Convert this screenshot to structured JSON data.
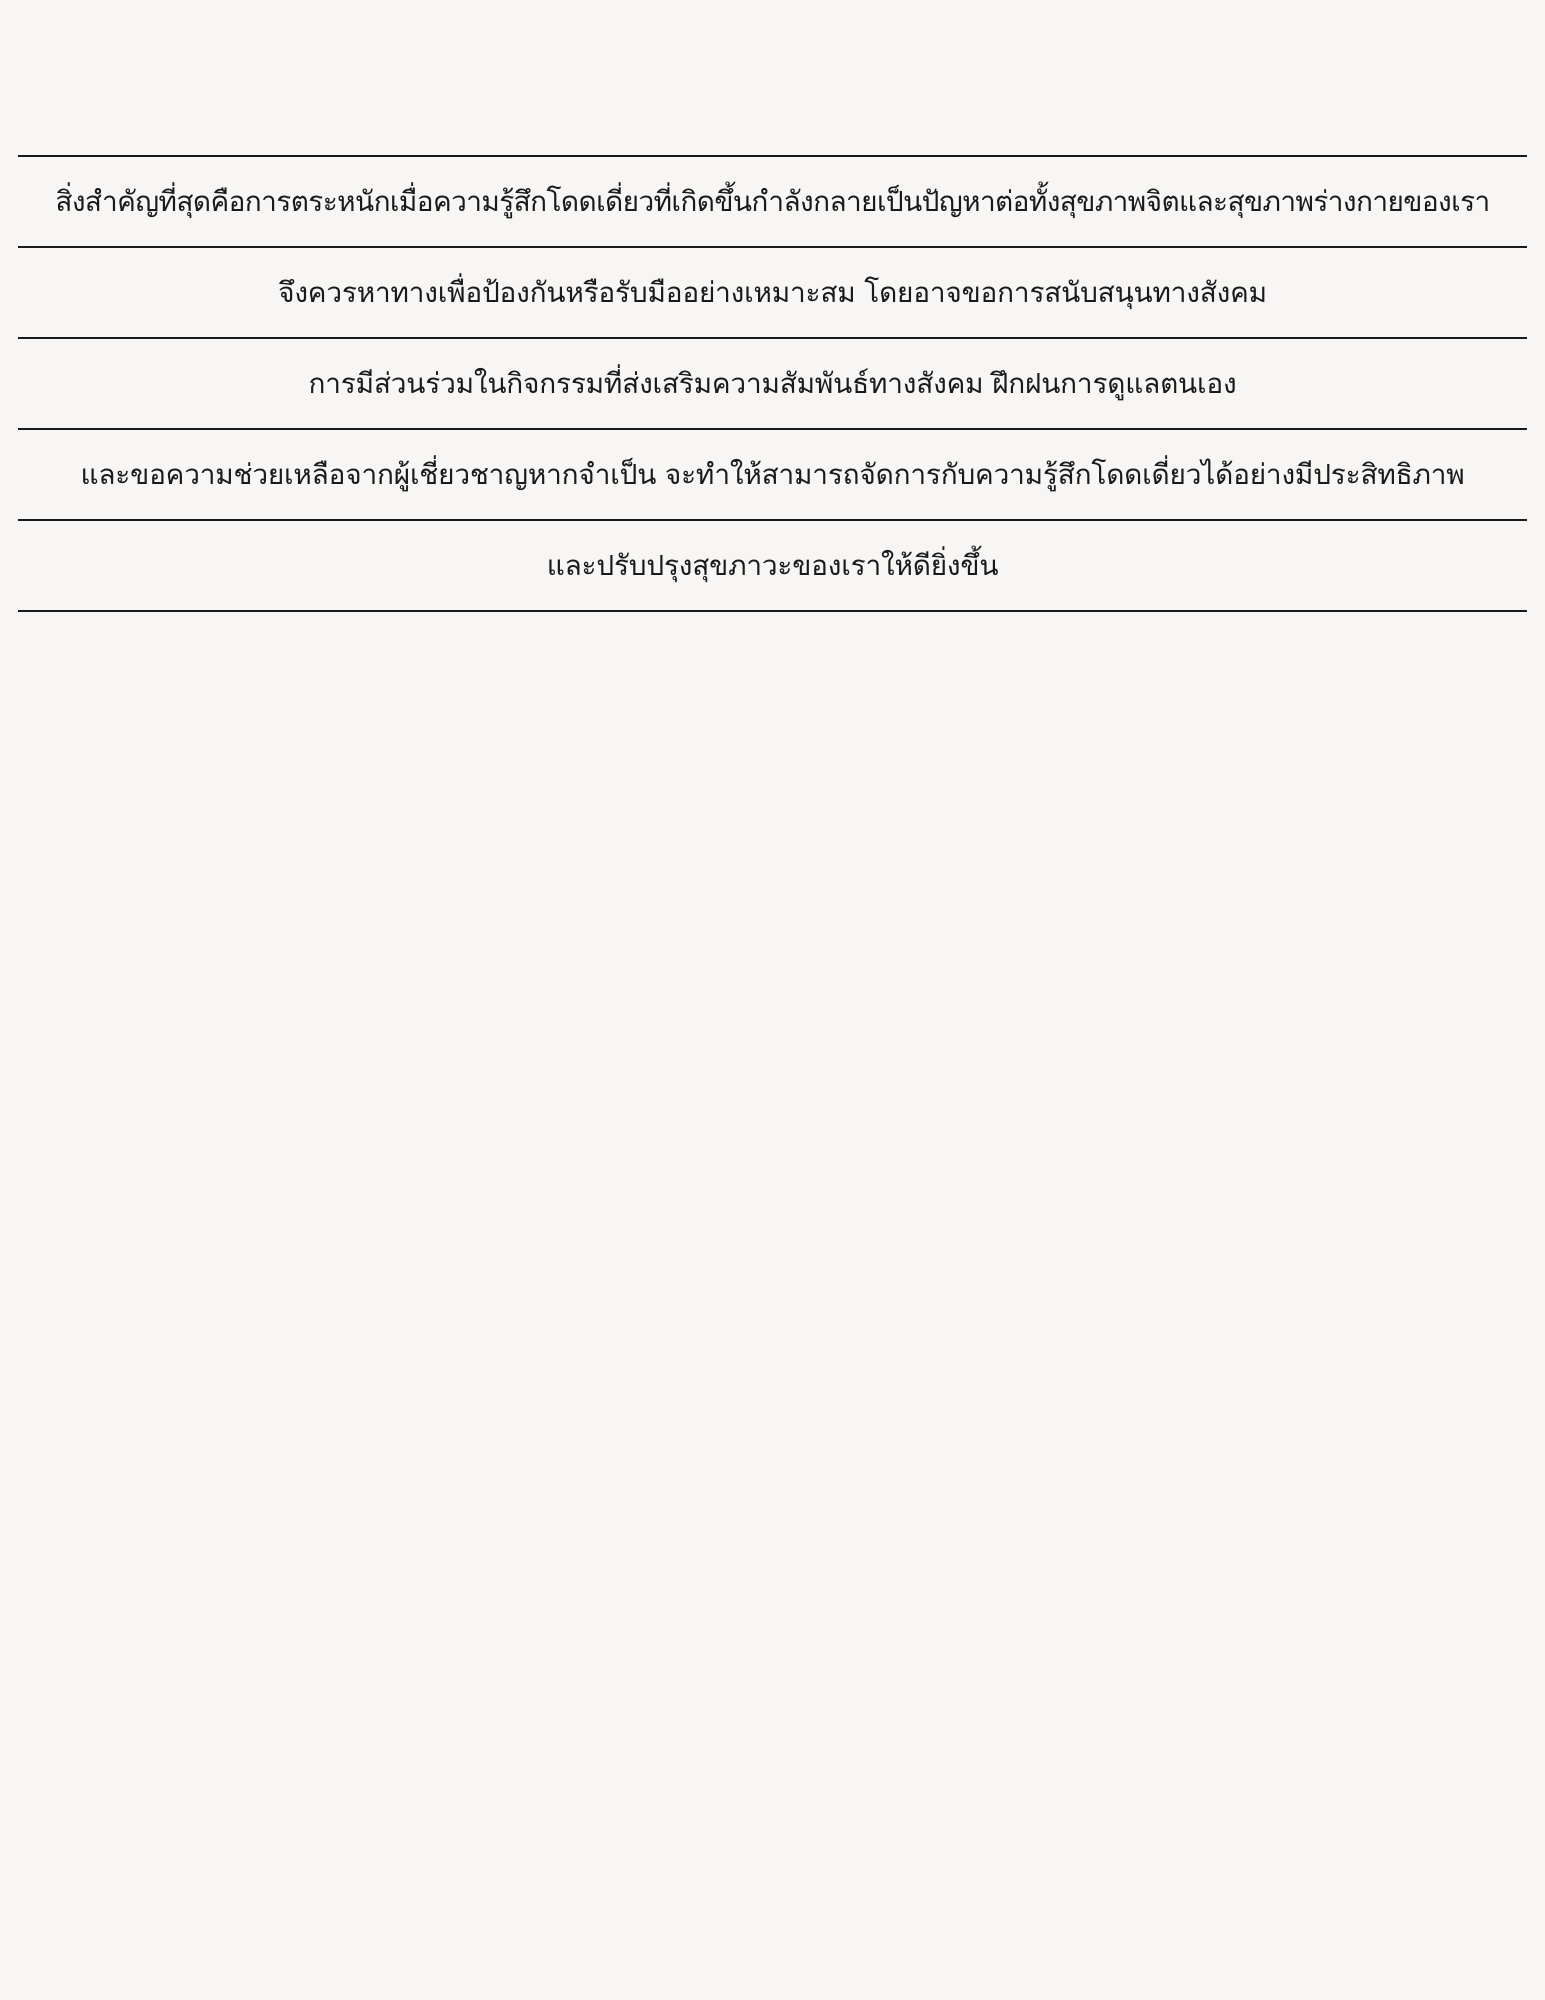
{
  "lines": [
    "สิ่งสำคัญที่สุดคือการตระหนักเมื่อความรู้สึกโดดเดี่ยวที่เกิดขึ้นกำลังกลายเป็นปัญหาต่อทั้งสุขภาพจิตและสุขภาพร่างกายของเรา",
    "จึงควรหาทางเพื่อป้องกันหรือรับมืออย่างเหมาะสม โดยอาจขอการสนับสนุนทางสังคม",
    "การมีส่วนร่วมในกิจกรรมที่ส่งเสริมความสัมพันธ์ทางสังคม ฝึกฝนการดูแลตนเอง",
    "และขอความช่วยเหลือจากผู้เชี่ยวชาญหากจำเป็น จะทำให้สามารถจัดการกับความรู้สึกโดดเดี่ยวได้อย่างมีประสิทธิภาพ",
    "และปรับปรุงสุขภาวะของเราให้ดียิ่งขึ้น"
  ]
}
